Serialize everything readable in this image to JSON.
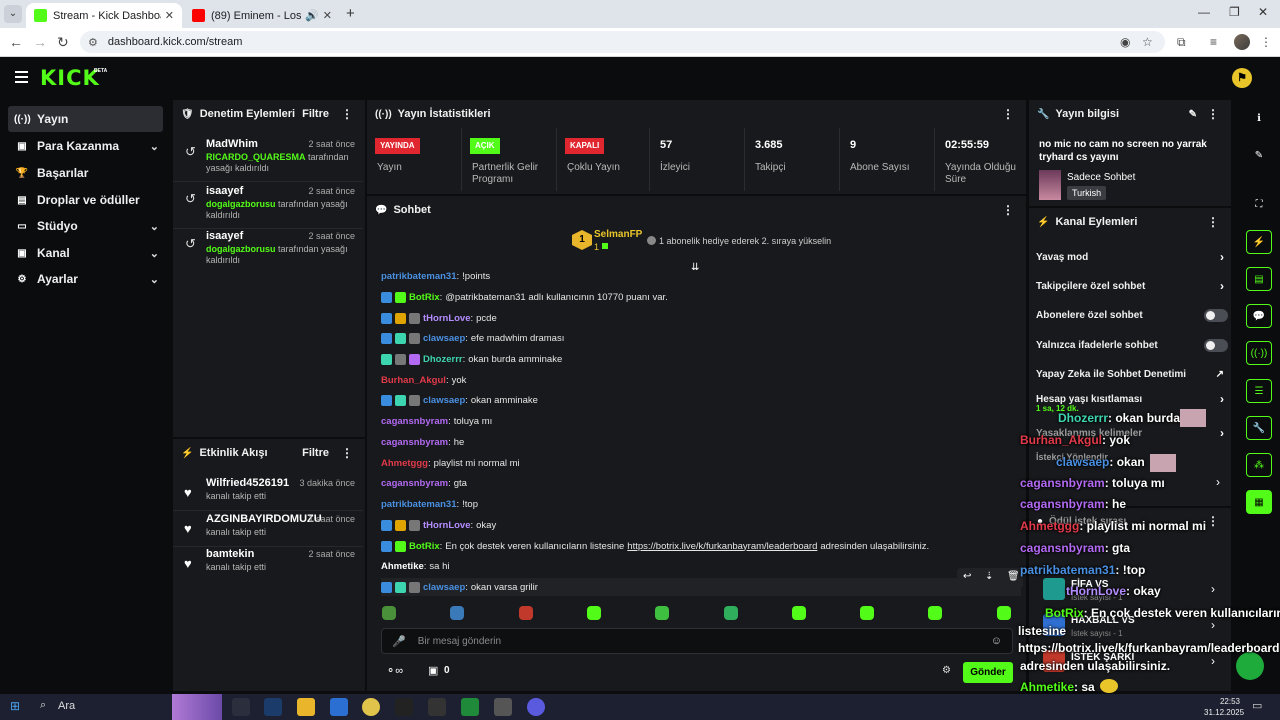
{
  "browser": {
    "tabs": [
      {
        "title": "Stream - Kick Dashboard",
        "favicon_color": "#53fc18"
      },
      {
        "title": "(89) Eminem - Lose Yourself",
        "favicon_color": "#ff0000"
      }
    ],
    "url": "dashboard.kick.com/stream"
  },
  "header": {
    "logo": "KICK",
    "beta": "BETA"
  },
  "leftnav": {
    "items": [
      {
        "label": "Yayın",
        "icon": "broadcast-icon"
      },
      {
        "label": "Para Kazanma",
        "icon": "money-icon"
      },
      {
        "label": "Başarılar",
        "icon": "trophy-icon"
      },
      {
        "label": "Droplar ve ödüller",
        "icon": "gift-icon"
      },
      {
        "label": "Stüdyo",
        "icon": "studio-icon"
      },
      {
        "label": "Kanal",
        "icon": "channel-icon"
      },
      {
        "label": "Ayarlar",
        "icon": "gear-icon"
      }
    ]
  },
  "moderation": {
    "title": "Denetim Eylemleri",
    "filter": "Filtre",
    "items": [
      {
        "user": "MadWhim",
        "time": "2 saat önce",
        "target": "RICARDO_QUARESMA",
        "action": "tarafından yasağı kaldırıldı"
      },
      {
        "user": "isaayef",
        "time": "2 saat önce",
        "target": "dogalgazborusu",
        "action": "tarafından yasağı kaldırıldı"
      },
      {
        "user": "isaayef",
        "time": "2 saat önce",
        "target": "dogalgazborusu",
        "action": "tarafından yasağı kaldırıldı"
      }
    ]
  },
  "activity": {
    "title": "Etkinlik Akışı",
    "filter": "Filtre",
    "items": [
      {
        "user": "Wilfried4526191",
        "time": "3 dakika önce",
        "desc": "kanalı takip etti"
      },
      {
        "user": "AZGINBAYIRDOMUZU",
        "time": "1 saat önce",
        "desc": "kanalı takip etti"
      },
      {
        "user": "bamtekin",
        "time": "2 saat önce",
        "desc": "kanalı takip etti"
      }
    ]
  },
  "stats": {
    "title": "Yayın İstatistikleri",
    "items": [
      {
        "badge": "YAYINDA",
        "label": "Yayın"
      },
      {
        "badge": "AÇIK",
        "label": "Partnerlik Gelir Programı"
      },
      {
        "badge": "KAPALI",
        "label": "Çoklu Yayın"
      },
      {
        "value": "57",
        "label": "İzleyici"
      },
      {
        "value": "3.685",
        "label": "Takipçi"
      },
      {
        "value": "9",
        "label": "Abone Sayısı"
      },
      {
        "value": "02:55:59",
        "label": "Yayında Olduğu Süre"
      }
    ]
  },
  "chat": {
    "title": "Sohbet",
    "pinned_user": "SelmanFP",
    "pinned_count": "1",
    "pinned_rank": "1",
    "gift_text": "1 abonelik hediye ederek 2. sıraya yükselin",
    "messages": [
      {
        "user": "patrikbateman31",
        "color": "#4a90e2",
        "text": "!points",
        "badges": []
      },
      {
        "user": "BotRix",
        "color": "#53fc18",
        "text": "@patrikbateman31 adlı kullanıcının 10770 puanı var.",
        "badges": [
          "#3a8dde",
          "#53fc18"
        ]
      },
      {
        "user": "tHornLove",
        "color": "#b38cff",
        "text": "pcde",
        "badges": [
          "#3a8dde",
          "#e0a400",
          "#777"
        ]
      },
      {
        "user": "clawsaep",
        "color": "#4a90e2",
        "text": "efe madwhim draması",
        "badges": [
          "#3a8dde",
          "#3dd5b0",
          "#777"
        ]
      },
      {
        "user": "Dhozerrr",
        "color": "#3dd5b0",
        "text": "okan burda amminake",
        "badges": [
          "#3dd5b0",
          "#777",
          "#b26af2"
        ]
      },
      {
        "user": "Burhan_Akgul",
        "color": "#e23a4a",
        "text": "yok",
        "badges": []
      },
      {
        "user": "clawsaep",
        "color": "#4a90e2",
        "text": "okan amminake",
        "badges": [
          "#3a8dde",
          "#3dd5b0",
          "#777"
        ]
      },
      {
        "user": "cagansnbyram",
        "color": "#b26af2",
        "text": "toluya mı",
        "badges": []
      },
      {
        "user": "cagansnbyram",
        "color": "#b26af2",
        "text": "he",
        "badges": []
      },
      {
        "user": "Ahmetggg",
        "color": "#e23a4a",
        "text": "playlist mi normal mi",
        "badges": []
      },
      {
        "user": "cagansnbyram",
        "color": "#b26af2",
        "text": "gta",
        "badges": []
      },
      {
        "user": "patrikbateman31",
        "color": "#4a90e2",
        "text": "!top",
        "badges": []
      },
      {
        "user": "tHornLove",
        "color": "#b38cff",
        "text": "okay",
        "badges": [
          "#3a8dde",
          "#e0a400",
          "#777"
        ]
      },
      {
        "user": "BotRix",
        "color": "#53fc18",
        "text": "En çok destek veren kullanıcıların listesine",
        "link": "https://botrix.live/k/furkanbayram/leaderboard",
        "after": "adresinden ulaşabilirsiniz.",
        "badges": [
          "#3a8dde",
          "#53fc18"
        ]
      },
      {
        "user": "Ahmetike",
        "color": "#ffffff",
        "text": "sa hi",
        "badges": []
      },
      {
        "user": "clawsaep",
        "color": "#4a90e2",
        "text": "okan varsa grilir",
        "badges": [
          "#3a8dde",
          "#3dd5b0",
          "#777"
        ]
      }
    ],
    "input_placeholder": "Bir mesaj gönderin",
    "points_value": "0",
    "send_label": "Gönder"
  },
  "stream_info": {
    "title": "Yayın bilgisi",
    "stream_title": "no mic no cam no screen no yarrak tryhard cs yayını",
    "category": "Sadece Sohbet",
    "tag": "Turkish"
  },
  "channel_actions": {
    "title": "Kanal Eylemleri",
    "items": [
      {
        "label": "Yavaş mod"
      },
      {
        "label": "Takipçilere özel sohbet"
      },
      {
        "label": "Abonelere özel sohbet"
      },
      {
        "label": "Yalnızca ifadelerle sohbet"
      },
      {
        "label": "Yapay Zeka ile Sohbet Denetimi"
      },
      {
        "label": "Hesap yaşı kısıtlaması"
      },
      {
        "label": "Yasaklanmış kelimeler"
      },
      {
        "label": "İstekci Yönlendir"
      }
    ]
  },
  "requests": {
    "title": "Ödül istek sırası",
    "items": [
      {
        "name": "FİFA VS",
        "count": "İstek sayısı - 1"
      },
      {
        "name": "HAXBALL VS",
        "count": "İstek sayısı - 1"
      },
      {
        "name": "İSTEK ŞARKI",
        "count": ""
      }
    ]
  },
  "overlay": {
    "lines": [
      {
        "user": "Dhozerrr",
        "color": "#3dd5b0",
        "text": ": okan burda"
      },
      {
        "user": "Burhan_Akgul",
        "color": "#e23a4a",
        "text": ": yok"
      },
      {
        "user": "clawsaep",
        "color": "#4a90e2",
        "text": ": okan"
      },
      {
        "user": "cagansnbyram",
        "color": "#b26af2",
        "text": ": toluya mı"
      },
      {
        "user": "cagansnbyram",
        "color": "#b26af2",
        "text": ": he"
      },
      {
        "user": "Ahmetggg",
        "color": "#e23a4a",
        "text": ": playlist mi normal mi"
      },
      {
        "user": "cagansnbyram",
        "color": "#b26af2",
        "text": ": gta"
      },
      {
        "user": "patrikbateman31",
        "color": "#4a90e2",
        "text": ": !top"
      },
      {
        "user": "tHornLove",
        "color": "#b38cff",
        "text": ": okay"
      },
      {
        "user": "BotRix",
        "color": "#53fc18",
        "text": ": En çok destek veren kullanıcıların"
      },
      {
        "user": "",
        "color": "#ffffff",
        "text": "listesine"
      },
      {
        "user": "",
        "color": "#ffffff",
        "text": "https://botrix.live/k/furkanbayram/leaderboard"
      },
      {
        "user": "",
        "color": "#ffffff",
        "text": "adresinden ulaşabilirsiniz."
      },
      {
        "user": "Ahmetike",
        "color": "#53fc18",
        "text": ": sa"
      },
      {
        "user": "clawsaep",
        "color": "#4a90e2",
        "text": ": okan varsa grilir"
      }
    ],
    "time_label": "1 sa, 12 dk."
  },
  "taskbar": {
    "search": "Ara",
    "time": "22:53",
    "date": "31.12.2025"
  },
  "colors": {
    "accent": "#53fc18",
    "panel": "#18191c",
    "bg": "#0b0c0e"
  }
}
